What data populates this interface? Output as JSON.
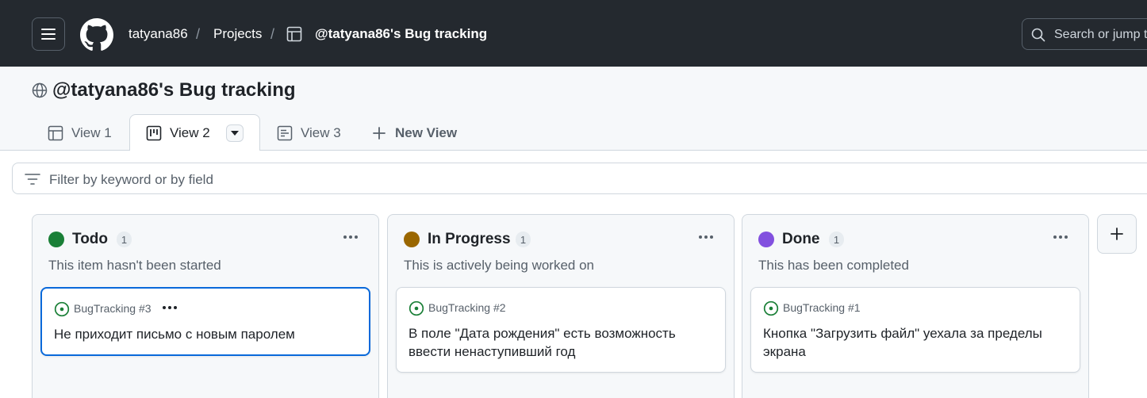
{
  "header": {
    "breadcrumb": {
      "owner": "tatyana86",
      "projects": "Projects",
      "project": "@tatyana86's Bug tracking",
      "separator": "/"
    },
    "search_placeholder": "Search or jump to..."
  },
  "project": {
    "title": "@tatyana86's Bug tracking",
    "tabs": [
      {
        "label": "View 1",
        "icon": "table-icon"
      },
      {
        "label": "View 2",
        "icon": "board-icon",
        "active": true
      },
      {
        "label": "View 3",
        "icon": "roadmap-icon"
      }
    ],
    "new_view_label": "New View"
  },
  "filter": {
    "placeholder": "Filter by keyword or by field"
  },
  "columns": [
    {
      "title": "Todo",
      "count": "1",
      "color": "#1a7f37",
      "description": "This item hasn't been started",
      "cards": [
        {
          "ref": "BugTracking #3",
          "title": "Не приходит письмо с новым паролем",
          "selected": true
        }
      ]
    },
    {
      "title": "In Progress",
      "count": "1",
      "color": "#9a6700",
      "description": "This is actively being worked on",
      "cards": [
        {
          "ref": "BugTracking #2",
          "title": "В поле \"Дата рождения\" есть возможность ввести ненаступивший год"
        }
      ]
    },
    {
      "title": "Done",
      "count": "1",
      "color": "#8250df",
      "description": "This has been completed",
      "cards": [
        {
          "ref": "BugTracking #1",
          "title": "Кнопка \"Загрузить файл\" уехала за пределы экрана"
        }
      ]
    }
  ],
  "colors": {
    "header_bg": "#24292f",
    "accent": "#0969da",
    "open_issue": "#1a7f37"
  }
}
